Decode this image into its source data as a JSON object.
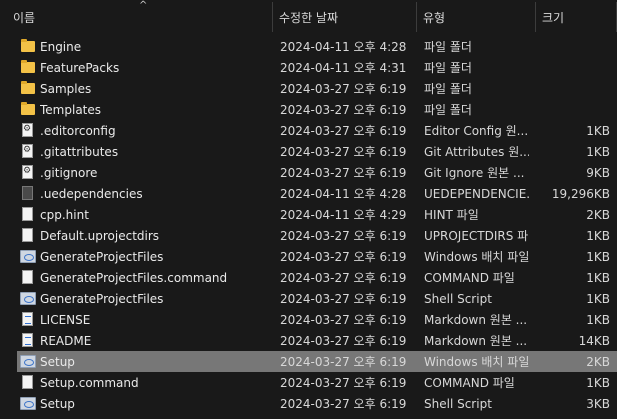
{
  "columns": {
    "name": "이름",
    "date": "수정한 날짜",
    "type": "유형",
    "size": "크기"
  },
  "files": [
    {
      "icon": "folder-icon",
      "name": "Engine",
      "date": "2024-04-11 오후 4:28",
      "type": "파일 폴더",
      "size": ""
    },
    {
      "icon": "folder-icon",
      "name": "FeaturePacks",
      "date": "2024-04-11 오후 4:31",
      "type": "파일 폴더",
      "size": ""
    },
    {
      "icon": "folder-icon",
      "name": "Samples",
      "date": "2024-03-27 오후 6:19",
      "type": "파일 폴더",
      "size": ""
    },
    {
      "icon": "folder-icon",
      "name": "Templates",
      "date": "2024-03-27 오후 6:19",
      "type": "파일 폴더",
      "size": ""
    },
    {
      "icon": "config-file-icon",
      "name": ".editorconfig",
      "date": "2024-03-27 오후 6:19",
      "type": "Editor Config 원...",
      "size": "1KB"
    },
    {
      "icon": "config-file-icon",
      "name": ".gitattributes",
      "date": "2024-03-27 오후 6:19",
      "type": "Git Attributes 원...",
      "size": "1KB"
    },
    {
      "icon": "config-file-icon",
      "name": ".gitignore",
      "date": "2024-03-27 오후 6:19",
      "type": "Git Ignore 원본 ...",
      "size": "9KB"
    },
    {
      "icon": "dark-file-icon",
      "name": ".uedependencies",
      "date": "2024-04-11 오후 4:28",
      "type": "UEDEPENDENCIE...",
      "size": "19,296KB"
    },
    {
      "icon": "file-icon",
      "name": "cpp.hint",
      "date": "2024-04-11 오후 4:29",
      "type": "HINT 파일",
      "size": "2KB"
    },
    {
      "icon": "file-icon",
      "name": "Default.uprojectdirs",
      "date": "2024-03-27 오후 6:19",
      "type": "UPROJECTDIRS 파...",
      "size": "1KB"
    },
    {
      "icon": "batch-file-icon",
      "name": "GenerateProjectFiles",
      "date": "2024-03-27 오후 6:19",
      "type": "Windows 배치 파일",
      "size": "1KB"
    },
    {
      "icon": "file-icon",
      "name": "GenerateProjectFiles.command",
      "date": "2024-03-27 오후 6:19",
      "type": "COMMAND 파일",
      "size": "1KB"
    },
    {
      "icon": "batch-file-icon",
      "name": "GenerateProjectFiles",
      "date": "2024-03-27 오후 6:19",
      "type": "Shell Script",
      "size": "1KB"
    },
    {
      "icon": "text-file-icon",
      "name": "LICENSE",
      "date": "2024-03-27 오후 6:19",
      "type": "Markdown 원본 ...",
      "size": "1KB"
    },
    {
      "icon": "text-file-icon",
      "name": "README",
      "date": "2024-03-27 오후 6:19",
      "type": "Markdown 원본 ...",
      "size": "14KB"
    },
    {
      "icon": "batch-file-icon",
      "name": "Setup",
      "date": "2024-03-27 오후 6:19",
      "type": "Windows 배치 파일",
      "size": "2KB",
      "selected": true
    },
    {
      "icon": "file-icon",
      "name": "Setup.command",
      "date": "2024-03-27 오후 6:19",
      "type": "COMMAND 파일",
      "size": "1KB"
    },
    {
      "icon": "batch-file-icon",
      "name": "Setup",
      "date": "2024-03-27 오후 6:19",
      "type": "Shell Script",
      "size": "3KB"
    }
  ],
  "colors": {
    "background": "#191919",
    "selection": "#777777",
    "folder": "#f3c247"
  }
}
